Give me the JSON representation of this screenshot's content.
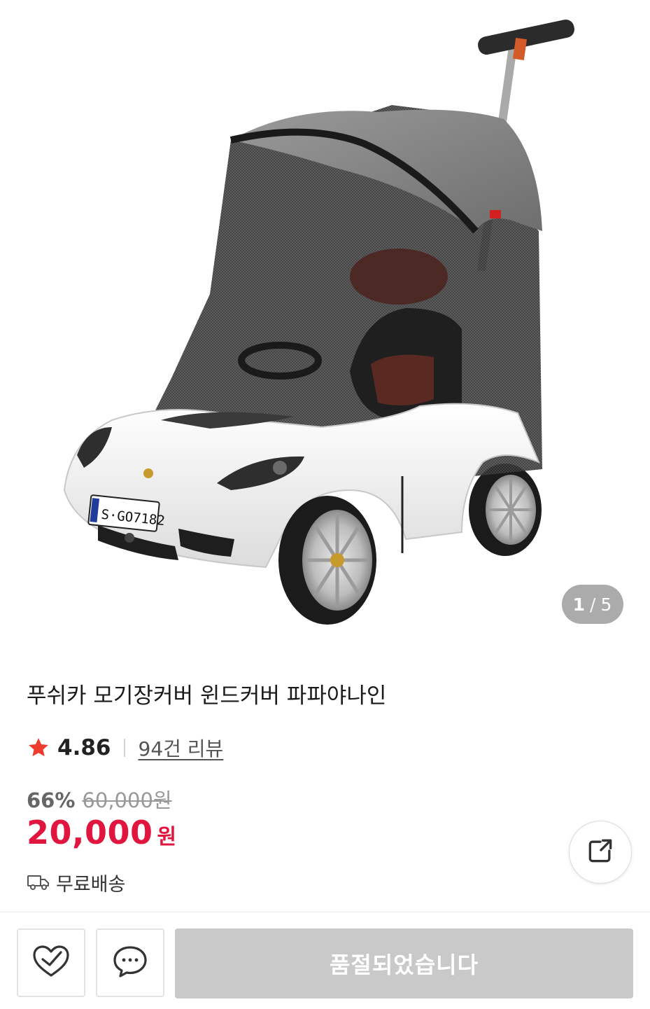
{
  "gallery": {
    "current_index": "1",
    "separator": "/",
    "total": "5",
    "image_alt": "product-photo"
  },
  "product": {
    "title": "푸쉬카 모기장커버 윈드커버 파파야나인",
    "rating": "4.86",
    "review_link": "94건 리뷰",
    "discount_rate": "66%",
    "original_price": "60,000원",
    "sale_price": "20,000",
    "price_unit": "원",
    "shipping": "무료배송"
  },
  "actions": {
    "soldout_label": "품절되었습니다"
  },
  "colors": {
    "accent_red": "#e0163f",
    "star": "#ef3b2c",
    "disabled_button": "#c9c9c9"
  },
  "icons": {
    "share": "share-icon",
    "wishlist": "heart-check-icon",
    "chat": "chat-bubble-icon",
    "shipping": "truck-icon",
    "rating": "star-icon"
  }
}
